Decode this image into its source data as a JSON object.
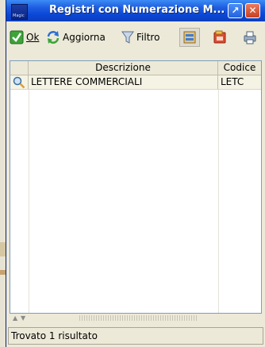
{
  "window": {
    "title": "Registri con Numerazione M...",
    "app_icon_label": "Magic"
  },
  "toolbar": {
    "ok_label": "Ok",
    "aggiorna_label": "Aggiorna",
    "filtro_label": "Filtro"
  },
  "grid": {
    "columns": [
      "Descrizione",
      "Codice"
    ],
    "rows": [
      {
        "descrizione": "LETTERE COMMERCIALI",
        "codice": "LETC"
      }
    ]
  },
  "status": {
    "text": "Trovato 1 risultato"
  },
  "colors": {
    "title_bar": "#0a46d6",
    "selected_row": "#f5f3e4",
    "window_bg": "#ece9d8"
  }
}
